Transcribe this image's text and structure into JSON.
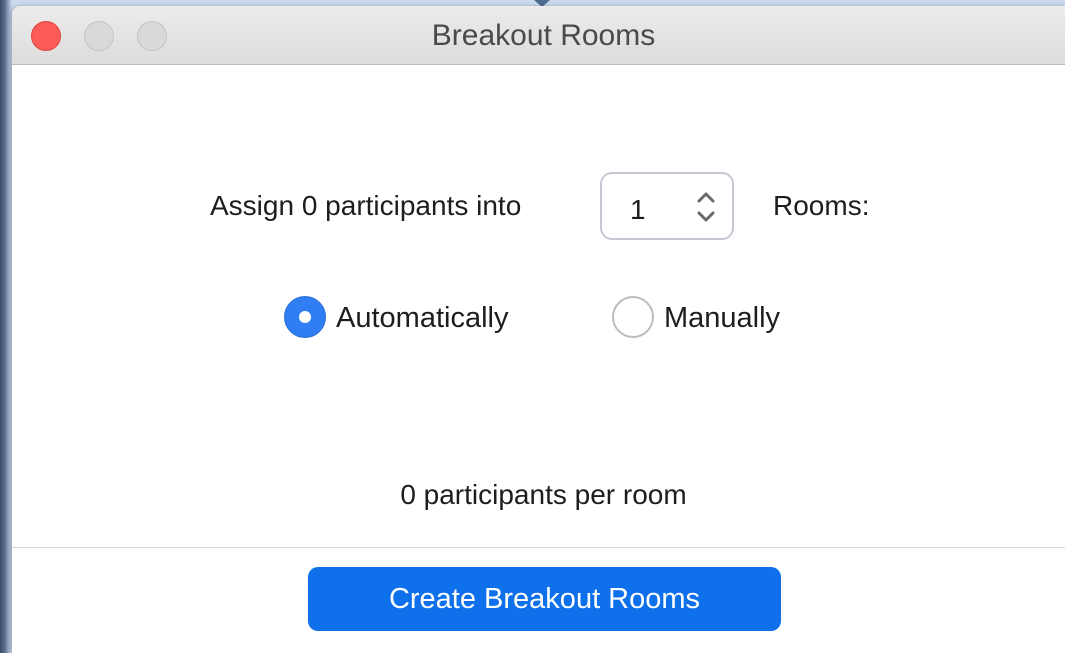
{
  "window": {
    "title": "Breakout Rooms"
  },
  "assign": {
    "prefix_label": "Assign 0 participants into",
    "rooms_value": "1",
    "suffix_label": "Rooms:"
  },
  "assignment_mode": {
    "options": [
      {
        "label": "Automatically",
        "selected": true
      },
      {
        "label": "Manually",
        "selected": false
      }
    ]
  },
  "summary": {
    "per_room_text": "0 participants per room"
  },
  "actions": {
    "create_label": "Create Breakout Rooms"
  },
  "colors": {
    "accent": "#0e71eb",
    "radio_selected": "#2f7ef3",
    "close_button": "#fc5b57"
  },
  "icons": {
    "stepper": "chevron-up-down-icon",
    "close": "close-traffic-light",
    "minimize": "minimize-traffic-light",
    "zoom": "zoom-traffic-light"
  }
}
